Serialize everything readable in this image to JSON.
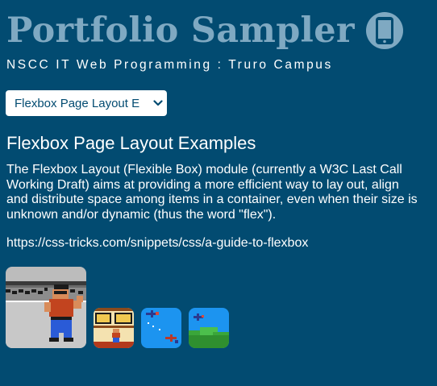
{
  "header": {
    "title": "Portfolio Sampler",
    "icon": "phone-icon",
    "subtitle": "NSCC IT Web Programming : Truro Campus"
  },
  "nav": {
    "selected_label": "Flexbox Page Layout E",
    "icon": "chevron-down-icon"
  },
  "main": {
    "heading": "Flexbox Page Layout Examples",
    "description": "The Flexbox Layout (Flexible Box) module (currently a W3C Last Call Working Draft) aims at providing a more efficient way to lay out, align and distribute space among items in a container, even when their size is unknown and/or dynamic (thus the word \"flex\").",
    "link": "https://css-tricks.com/snippets/css/a-guide-to-flexbox"
  },
  "gallery": {
    "thumbnails": [
      {
        "name": "pixel-brawler-thumbnail",
        "state": "enlarged"
      },
      {
        "name": "pixel-street-scene-thumbnail",
        "state": "normal"
      },
      {
        "name": "pixel-planes-sky-thumbnail",
        "state": "normal"
      },
      {
        "name": "pixel-plane-hills-thumbnail",
        "state": "normal"
      }
    ]
  },
  "colors": {
    "background": "#024b71",
    "title_accent": "#7fa9c2",
    "text": "#ffffff"
  }
}
